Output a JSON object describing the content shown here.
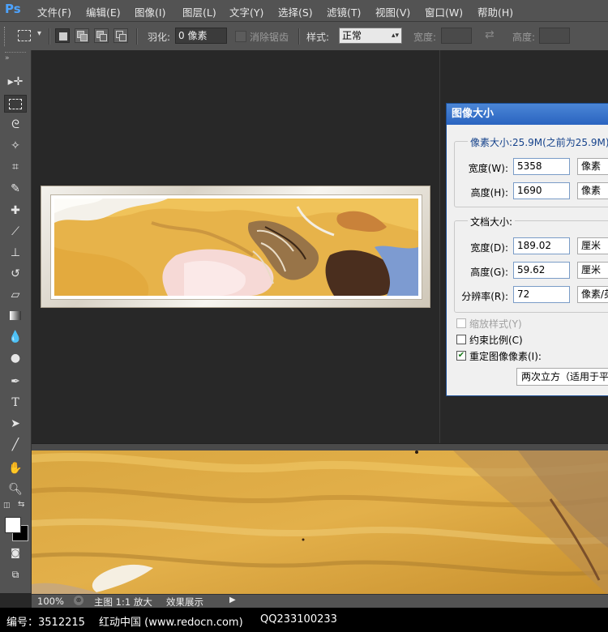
{
  "app": {
    "logo": "Ps"
  },
  "menu": [
    "文件(F)",
    "编辑(E)",
    "图像(I)",
    "图层(L)",
    "文字(Y)",
    "选择(S)",
    "滤镜(T)",
    "视图(V)",
    "窗口(W)",
    "帮助(H)"
  ],
  "options": {
    "feather_label": "羽化:",
    "feather_value": "0 像素",
    "antialias_label": "消除锯齿",
    "style_label": "样式:",
    "style_value": "正常",
    "width_label": "宽度:",
    "height_label": "高度:"
  },
  "dialog": {
    "title": "图像大小",
    "pixel_group": "像素大小:25.9M(之前为25.9M)",
    "px_width_label": "宽度(W):",
    "px_width_value": "5358",
    "px_width_unit": "像素",
    "px_height_label": "高度(H):",
    "px_height_value": "1690",
    "px_height_unit": "像素",
    "doc_group": "文档大小:",
    "doc_width_label": "宽度(D):",
    "doc_width_value": "189.02",
    "doc_width_unit": "厘米",
    "doc_height_label": "高度(G):",
    "doc_height_value": "59.62",
    "doc_height_unit": "厘米",
    "resolution_label": "分辨率(R):",
    "resolution_value": "72",
    "resolution_unit": "像素/英",
    "scale_styles": "缩放样式(Y)",
    "constrain": "约束比例(C)",
    "resample": "重定图像像素(I):",
    "resample_method": "两次立方（适用于平"
  },
  "status": {
    "zoom": "100%",
    "items": [
      "主图 1:1 放大",
      "效果展示"
    ]
  },
  "footer": {
    "id": "编号：3512215",
    "site": "红动中国 (www.redocn.com)",
    "qq": "QQ233100233"
  },
  "colors": {
    "dialog_title": "#2a64c0",
    "marble_gold": "#e0a53a",
    "workspace": "#282828"
  }
}
